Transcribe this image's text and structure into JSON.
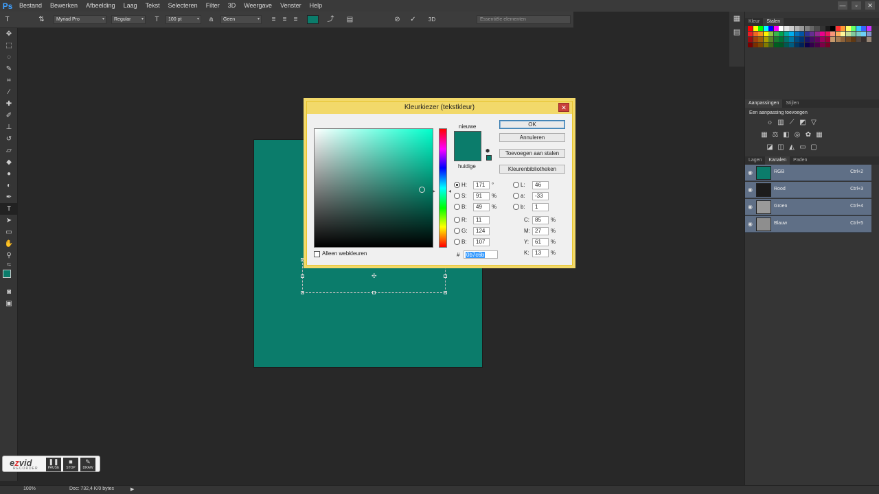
{
  "app": {
    "logo": "Ps"
  },
  "menu": [
    "Bestand",
    "Bewerken",
    "Afbeelding",
    "Laag",
    "Tekst",
    "Selecteren",
    "Filter",
    "3D",
    "Weergave",
    "Venster",
    "Help"
  ],
  "window_controls": {
    "minimize": "—",
    "restore": "▫",
    "close": "✕"
  },
  "options_bar": {
    "font_family": "Myriad Pro",
    "font_style": "Regular",
    "font_size": "100 pt",
    "antialias": "Geen",
    "workspace": "Essentiële elementen",
    "text_color": "#0b7c6b",
    "three_d": "3D"
  },
  "dialog": {
    "title": "Kleurkiezer (tekstkleur)",
    "close": "✕",
    "new_label": "nieuwe",
    "current_label": "huidige",
    "new_color": "#0b7c6b",
    "current_color": "#0b7c6b",
    "buttons": {
      "ok": "OK",
      "cancel": "Annuleren",
      "add_swatches": "Toevoegen aan stalen",
      "libraries": "Kleurenbibliotheken"
    },
    "hsb": {
      "H": {
        "label": "H:",
        "value": "171",
        "unit": "°"
      },
      "S": {
        "label": "S:",
        "value": "91",
        "unit": "%"
      },
      "B": {
        "label": "B:",
        "value": "49",
        "unit": "%"
      }
    },
    "rgb": {
      "R": {
        "label": "R:",
        "value": "11"
      },
      "G": {
        "label": "G:",
        "value": "124"
      },
      "B": {
        "label": "B:",
        "value": "107"
      }
    },
    "lab": {
      "L": {
        "label": "L:",
        "value": "46"
      },
      "a": {
        "label": "a:",
        "value": "-33"
      },
      "b": {
        "label": "b:",
        "value": "1"
      }
    },
    "cmyk": {
      "C": {
        "label": "C:",
        "value": "85",
        "unit": "%"
      },
      "M": {
        "label": "M:",
        "value": "27",
        "unit": "%"
      },
      "Y": {
        "label": "Y:",
        "value": "61",
        "unit": "%"
      },
      "K": {
        "label": "K:",
        "value": "13",
        "unit": "%"
      }
    },
    "web_only": "Alleen webkleuren",
    "hash": "#",
    "hex": "0b7c6b"
  },
  "panels": {
    "color_tabs": [
      "Kleur",
      "Stalen"
    ],
    "adjust_tabs": [
      "Aanpassingen",
      "Stijlen"
    ],
    "adjust_title": "Een aanpassing toevoegen",
    "layer_tabs": [
      "Lagen",
      "Kanalen",
      "Paden"
    ],
    "channels": [
      {
        "name": "RGB",
        "key": "Ctrl+2",
        "thumb": "#0b7c6b"
      },
      {
        "name": "Rood",
        "key": "Ctrl+3",
        "thumb": "#1c1c1c"
      },
      {
        "name": "Groen",
        "key": "Ctrl+4",
        "thumb": "#9a9a9a"
      },
      {
        "name": "Blauw",
        "key": "Ctrl+5",
        "thumb": "#8e8e8e"
      }
    ]
  },
  "status": {
    "zoom": "100%",
    "doc": "Doc: 732,4 K/0 bytes"
  },
  "recorder": {
    "brand_a": "e",
    "brand_z": "z",
    "brand_b": "vid",
    "sub": "RECORDER",
    "buttons": [
      "PAUSE",
      "STOP",
      "DRAW"
    ]
  }
}
